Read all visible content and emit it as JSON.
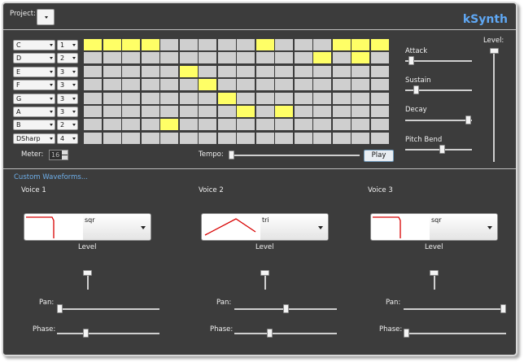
{
  "app": {
    "title": "kSynth"
  },
  "project": {
    "label": "Project:",
    "value": ""
  },
  "sequencer": {
    "rows": [
      {
        "note": "C",
        "octave": "1",
        "cells": [
          1,
          1,
          1,
          1,
          0,
          0,
          0,
          0,
          0,
          1,
          0,
          0,
          0,
          1,
          1,
          1
        ]
      },
      {
        "note": "D",
        "octave": "2",
        "cells": [
          0,
          0,
          0,
          0,
          0,
          0,
          0,
          0,
          0,
          0,
          0,
          0,
          1,
          0,
          1,
          0
        ]
      },
      {
        "note": "E",
        "octave": "3",
        "cells": [
          0,
          0,
          0,
          0,
          0,
          1,
          0,
          0,
          0,
          0,
          0,
          0,
          0,
          0,
          0,
          0
        ]
      },
      {
        "note": "F",
        "octave": "3",
        "cells": [
          0,
          0,
          0,
          0,
          0,
          0,
          1,
          0,
          0,
          0,
          0,
          0,
          0,
          0,
          0,
          0
        ]
      },
      {
        "note": "G",
        "octave": "3",
        "cells": [
          0,
          0,
          0,
          0,
          0,
          0,
          0,
          1,
          0,
          0,
          0,
          0,
          0,
          0,
          0,
          0
        ]
      },
      {
        "note": "A",
        "octave": "3",
        "cells": [
          0,
          0,
          0,
          0,
          0,
          0,
          0,
          0,
          1,
          0,
          1,
          0,
          0,
          0,
          0,
          0
        ]
      },
      {
        "note": "B",
        "octave": "2",
        "cells": [
          0,
          0,
          0,
          0,
          1,
          0,
          0,
          0,
          0,
          0,
          0,
          0,
          0,
          0,
          0,
          0
        ]
      },
      {
        "note": "DSharp",
        "octave": "4",
        "cells": [
          0,
          0,
          0,
          0,
          0,
          0,
          0,
          0,
          0,
          0,
          0,
          0,
          0,
          0,
          0,
          0
        ]
      }
    ],
    "meter_label": "Meter:",
    "meter_value": "16",
    "tempo_label": "Tempo:",
    "tempo_value": 0.0,
    "play_label": "Play"
  },
  "envelope": {
    "attack": {
      "label": "Attack",
      "value": 0.0
    },
    "sustain": {
      "label": "Sustain",
      "value": 0.08
    },
    "decay": {
      "label": "Decay",
      "value": 1.0
    },
    "pitch_bend": {
      "label": "Pitch Bend",
      "value": 0.55
    },
    "level": {
      "label": "Level:",
      "value": 1.0
    }
  },
  "waveforms": {
    "link_label": "Custom Waveforms...",
    "voices": [
      {
        "name": "Voice 1",
        "wave": "sqr",
        "level_label": "Level",
        "level": 1.0,
        "pan_label": "Pan:",
        "pan": 0.0,
        "phase_label": "Phase:",
        "phase": 0.4
      },
      {
        "name": "Voice 2",
        "wave": "tri",
        "level_label": "Level",
        "level": 1.0,
        "pan_label": "Pan:",
        "pan": 0.5,
        "phase_label": "Phase:",
        "phase": 0.5
      },
      {
        "name": "Voice 3",
        "wave": "sqr",
        "level_label": "Level",
        "level": 1.0,
        "pan_label": "Pan:",
        "pan": 1.0,
        "phase_label": "Phase:",
        "phase": 0.0
      }
    ]
  },
  "colors": {
    "accent": "#5fa8f5",
    "active_cell": "#ffff66",
    "inactive_cell": "#cfcfcf",
    "background": "#3c3c3c"
  }
}
